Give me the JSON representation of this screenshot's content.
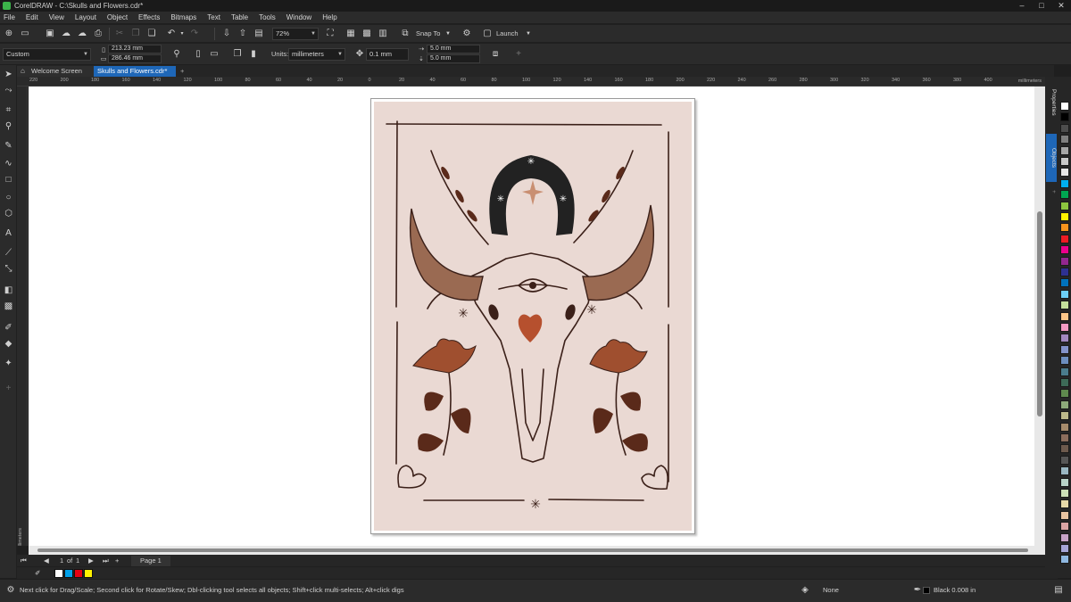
{
  "window": {
    "title": "CorelDRAW - C:\\Skulls and Flowers.cdr*",
    "controls": [
      "–",
      "□",
      "✕"
    ]
  },
  "menu": [
    "File",
    "Edit",
    "View",
    "Layout",
    "Object",
    "Effects",
    "Bitmaps",
    "Text",
    "Table",
    "Tools",
    "Window",
    "Help"
  ],
  "toolbar": {
    "zoom": "72%",
    "snap_to": "Snap To",
    "launch": "Launch"
  },
  "property_bar": {
    "page_preset": "Custom",
    "width": "213.23 mm",
    "height": "286.46 mm",
    "units_label": "Units:",
    "units_value": "millimeters",
    "nudge": "0.1 mm",
    "dup_x": "5.0 mm",
    "dup_y": "5.0 mm"
  },
  "tabs": {
    "welcome": "Welcome Screen",
    "document": "Skulls and Flowers.cdr*",
    "add": "+"
  },
  "ruler": {
    "h_labels": [
      "220",
      "200",
      "180",
      "160",
      "140",
      "120",
      "100",
      "80",
      "60",
      "40",
      "20",
      "0",
      "20",
      "40",
      "60",
      "80",
      "100",
      "120",
      "140",
      "160",
      "180",
      "200",
      "220",
      "240",
      "260",
      "280",
      "300",
      "320",
      "340",
      "360",
      "380",
      "400"
    ],
    "h_unit": "millimeters",
    "v_unit": "millimeters"
  },
  "dockers": {
    "properties": "Properties",
    "objects": "Objects"
  },
  "page_nav": {
    "current": "1",
    "of_label": "of",
    "total": "1",
    "add": "+",
    "page_label": "Page 1"
  },
  "status": {
    "hint": "Next click for Drag/Scale; Second click for Rotate/Skew; Dbl-clicking tool selects all objects; Shift+click multi-selects; Alt+click digs",
    "fill": "None",
    "outline": "Black  0.008 in"
  },
  "colors": {
    "art_background": "#ead9d3",
    "line": "#3b2019",
    "horn": "#9a6a52",
    "horn_light": "#b9866b",
    "flower": "#9f4f2f",
    "heart": "#b6502e",
    "horseshoe": "#222222",
    "star_accent": "#c98f72",
    "leaf": "#5a2a1a"
  },
  "palette": [
    "#ffffff",
    "#000000",
    "#4d4d4d",
    "#7f7f7f",
    "#a6a6a6",
    "#c9c9c9",
    "#e6e6e6",
    "#00aeef",
    "#00a651",
    "#8dc63f",
    "#fff200",
    "#f7941d",
    "#ed1c24",
    "#ec008c",
    "#92278f",
    "#2e3192",
    "#0072bc",
    "#6dcff6",
    "#c4df9b",
    "#fdc689",
    "#f49ac2",
    "#a187be",
    "#8393ca",
    "#6c8ebf",
    "#4a7c8c",
    "#3d6b57",
    "#5f8a4e",
    "#8da97a",
    "#bcb88a",
    "#a68b6b",
    "#8b6d5c",
    "#6d5a4d",
    "#565656",
    "#9ab7c2",
    "#b9d3c8",
    "#cce0b8",
    "#e6d9a8",
    "#e8c3a0",
    "#d9a3a3",
    "#c7a3c7",
    "#a5a5d6",
    "#8fb8e0"
  ],
  "doc_palette": [
    "#ffffff",
    "#00a0e9",
    "#e60012",
    "#fff100"
  ]
}
